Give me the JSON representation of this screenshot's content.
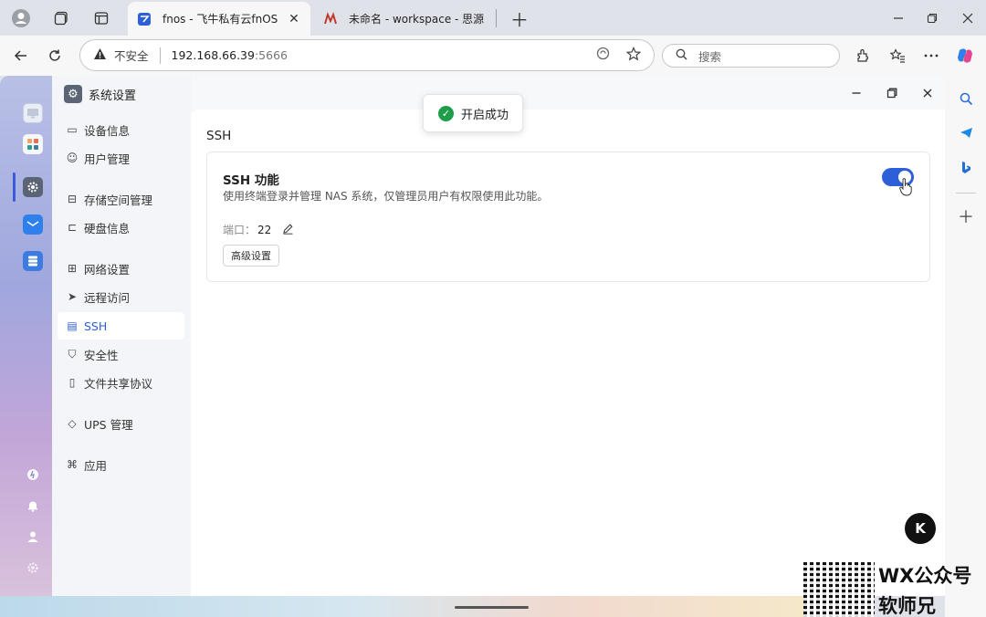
{
  "browser": {
    "tabs": [
      {
        "title": "fnos - 飞牛私有云fnOS",
        "close": "✕"
      },
      {
        "title": "未命名 - workspace - 思源笔"
      }
    ],
    "address": {
      "insecure_label": "不安全",
      "host": "192.168.66.39",
      "port": ":5666"
    },
    "search_placeholder": "搜索"
  },
  "app": {
    "title": "系统设置",
    "menu": [
      {
        "label": "设备信息",
        "icon": "monitor-icon"
      },
      {
        "label": "用户管理",
        "icon": "user-icon"
      },
      {
        "label": "存储空间管理",
        "icon": "storage-icon"
      },
      {
        "label": "硬盘信息",
        "icon": "disk-icon"
      },
      {
        "label": "网络设置",
        "icon": "network-icon"
      },
      {
        "label": "远程访问",
        "icon": "send-icon"
      },
      {
        "label": "SSH",
        "icon": "terminal-icon",
        "active": true
      },
      {
        "label": "安全性",
        "icon": "shield-icon"
      },
      {
        "label": "文件共享协议",
        "icon": "file-icon"
      },
      {
        "label": "UPS 管理",
        "icon": "ups-icon"
      },
      {
        "label": "应用",
        "icon": "apps-icon"
      }
    ]
  },
  "ssh": {
    "section_title": "SSH",
    "card_title": "SSH 功能",
    "description": "使用终端登录并管理 NAS 系统，仅管理员用户有权限使用此功能。",
    "port_label": "端口：",
    "port_value": "22",
    "advanced_button": "高级设置",
    "enabled": true
  },
  "toast": {
    "message": "开启成功"
  },
  "badge": {
    "letter": "K"
  },
  "watermark": {
    "line1": "WX公众号",
    "line2": "软师兄"
  },
  "colors": {
    "accent": "#2d5fd8",
    "success": "#1e9e4a"
  }
}
